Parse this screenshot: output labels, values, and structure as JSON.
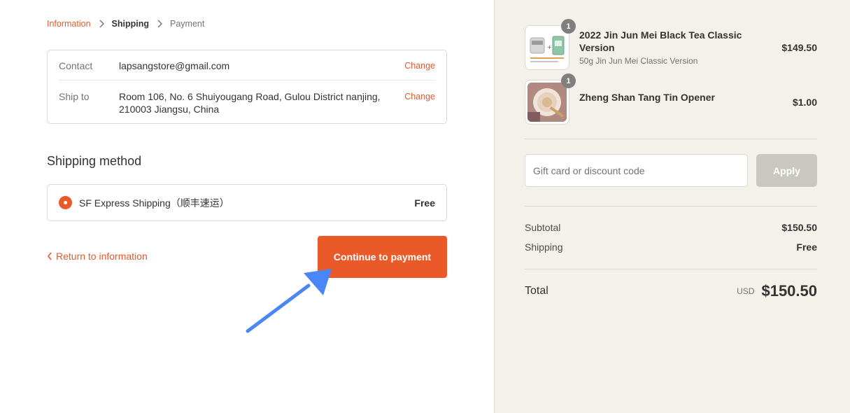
{
  "breadcrumb": {
    "information": "Information",
    "shipping": "Shipping",
    "payment": "Payment"
  },
  "review": {
    "contact_label": "Contact",
    "contact_value": "lapsangstore@gmail.com",
    "ship_label": "Ship to",
    "ship_value_line1": "Room 106, No. 6 Shuiyougang Road, Gulou District nanjing,",
    "ship_value_line2": "210003 Jiangsu, China",
    "change_label": "Change"
  },
  "shipping_method": {
    "title": "Shipping method",
    "option_label": "SF Express Shipping（顺丰速运）",
    "option_price": "Free"
  },
  "actions": {
    "return_label": "Return to information",
    "continue_label": "Continue to payment"
  },
  "cart": {
    "items": [
      {
        "name": "2022 Jin Jun Mei Black Tea Classic Version",
        "variant": "50g Jin Jun Mei Classic Version",
        "price": "$149.50",
        "quantity": "1"
      },
      {
        "name": "Zheng Shan Tang Tin Opener",
        "variant": "",
        "price": "$1.00",
        "quantity": "1"
      }
    ]
  },
  "discount": {
    "placeholder": "Gift card or discount code",
    "apply_label": "Apply"
  },
  "summary": {
    "subtotal_label": "Subtotal",
    "subtotal_value": "$150.50",
    "shipping_label": "Shipping",
    "shipping_value": "Free",
    "total_label": "Total",
    "currency": "USD",
    "total_value": "$150.50"
  },
  "colors": {
    "accent": "#ea5a28",
    "annotation_arrow": "#4a86f7",
    "sidebar_bg": "#f4f1ea"
  }
}
